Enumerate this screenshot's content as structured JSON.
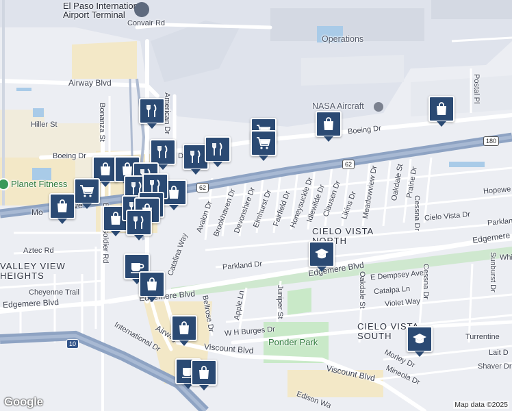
{
  "map": {
    "labels": {
      "airport": "El Paso International\nAirport Terminal",
      "convair": "Convair Rd",
      "airway_blvd": "Airway Blvd",
      "american_dr": "American Dr",
      "bonanza_st": "Bonanza St",
      "hiller_st": "Hiller St",
      "boeing_dr_w": "Boeing Dr",
      "boeing_dr_e": "Boeing Dr",
      "dr_frag": "Dr",
      "nasa": "NASA Aircraft",
      "operations": "Operations",
      "postal_pl": "Postal Pl",
      "planet_fitness": "Planet Fitness",
      "montana": "Mo",
      "montana_tail": "ve",
      "buffalo_soldier": "Buffalo Soldier Rd",
      "aztec_rd": "Aztec Rd",
      "valley_view": "VALLEY VIEW\nHEIGHTS",
      "cheyenne": "Cheyenne Trail",
      "edgemere_w": "Edgemere Blvd",
      "edgemere_mid": "Edgemere Blvd",
      "edgemere_mid2": "Edgemere Blvd",
      "edgemere_e": "Edgemere",
      "avalon": "Avalon Dr",
      "brookhaven": "Brookhaven Dr",
      "devonshire": "Devonshire Dr",
      "elmhurst": "Elmhurst Dr",
      "fairfield": "Fairfield Dr",
      "honeysuckle": "Honeysuckle Dr",
      "idlewilde": "Idlewilde Dr",
      "clausen": "Clausen Dr",
      "likins": "Likins Dr",
      "meadowview": "Meadowview Dr",
      "oakdale_n": "Oakdale St",
      "prairie": "Prairie Dr",
      "cessna_n": "Cessna Dr",
      "hopewell": "Hopewe",
      "cielo_vista_dr": "Cielo Vista Dr",
      "parkland_e": "Parkland",
      "cielo_vista_north": "CIELO VISTA\nNORTH",
      "parkland_dr": "Parkland Dr",
      "catalina": "Catalina Way",
      "whi": "Whi",
      "dempsey": "E Dempsey Ave",
      "catalpa": "Catalpa Ln",
      "violet": "Violet Way",
      "oakdale_s": "Oakdale St",
      "cessna_s": "Cessna Dr",
      "sunburst": "Sunburst Dr",
      "bellrose": "Bellrose Dr",
      "apple_ln": "Apple Ln",
      "juniper": "Juniper St",
      "wh_burges": "W H Burges Dr",
      "cielo_vista_south": "CIELO VISTA\nSOUTH",
      "turrentine": "Turrentine",
      "lait": "Lait D",
      "shaver": "Shaver Dr",
      "ponder_park": "Ponder Park",
      "airway_s": "Airway",
      "international": "International Dr",
      "viscount_w": "Viscount Blvd",
      "viscount_e": "Viscount Blvd",
      "morley": "Morley Dr",
      "mineola": "Mineola Dr",
      "edison": "Edison Wa"
    },
    "shields": {
      "us180": "180",
      "us62_a": "62",
      "us62_b": "62",
      "i10": "10"
    },
    "attribution": "Map data ©2025",
    "logo": "Google",
    "pins": [
      {
        "name": "shopping-bag-pin",
        "icon": "shopping-bag-icon"
      },
      {
        "name": "grocery-cart-pin",
        "icon": "cart-icon"
      },
      {
        "name": "restaurant-pin",
        "icon": "fork-knife-icon"
      },
      {
        "name": "school-pin",
        "icon": "graduation-cap-icon"
      },
      {
        "name": "cafe-pin",
        "icon": "coffee-cup-icon"
      }
    ],
    "colors": {
      "pin_fill": "#2b4a73",
      "highway": "#8ea3c3",
      "park": "#c9e9c8",
      "commercial": "#f3e8c7",
      "background": "#eceef3"
    }
  }
}
